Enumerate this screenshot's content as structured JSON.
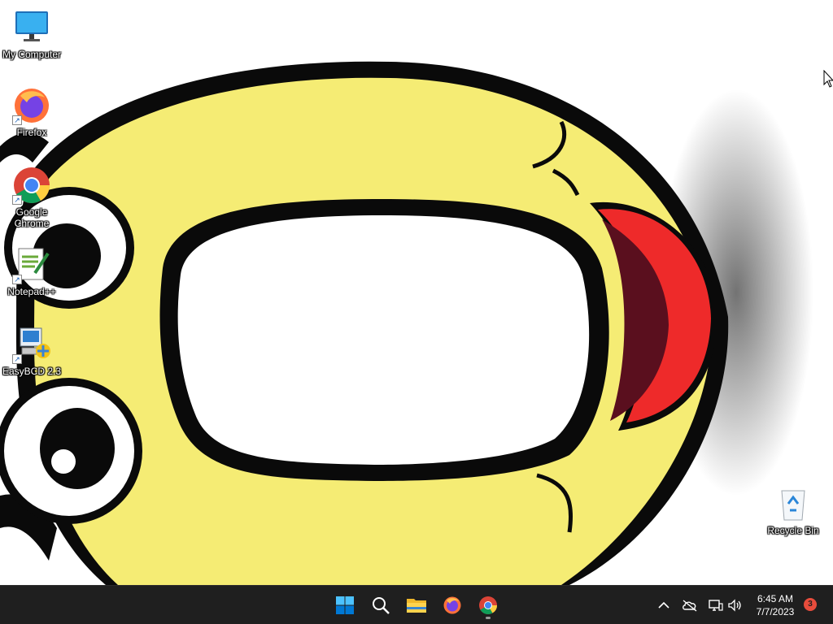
{
  "desktop": {
    "icons": [
      {
        "label": "My Computer",
        "icon": "monitor-icon"
      },
      {
        "label": "Firefox",
        "icon": "firefox-icon"
      },
      {
        "label": "Google Chrome",
        "icon": "chrome-icon"
      },
      {
        "label": "Notepad++",
        "icon": "notepadpp-icon"
      },
      {
        "label": "EasyBCD 2.3",
        "icon": "easybcd-icon"
      },
      {
        "label": "Recycle Bin",
        "icon": "recycle-bin-icon"
      }
    ],
    "wallpaper": {
      "description_icon": "cartoon-face-wallpaper",
      "colors": {
        "face": "#f5ec74",
        "outline": "#0a0a0a",
        "tongue": "#ee2a2a",
        "mouth_inner": "#5a0f1e"
      }
    }
  },
  "taskbar": {
    "pinned": [
      {
        "name": "start-button",
        "icon": "windows-logo-icon"
      },
      {
        "name": "search-button",
        "icon": "search-icon"
      },
      {
        "name": "file-explorer-button",
        "icon": "folder-icon"
      },
      {
        "name": "firefox-taskbar-button",
        "icon": "firefox-icon"
      },
      {
        "name": "chrome-taskbar-button",
        "icon": "chrome-icon",
        "running": true
      }
    ],
    "tray": {
      "icons": [
        "chevron-up-icon",
        "onedrive-offline-icon",
        "network-icon",
        "volume-icon"
      ],
      "time": "6:45 AM",
      "date": "7/7/2023",
      "notification_count": "3"
    },
    "colors": {
      "background": "#1f1f1f",
      "accent": "#0078d4",
      "badge": "#e74c3c"
    }
  }
}
